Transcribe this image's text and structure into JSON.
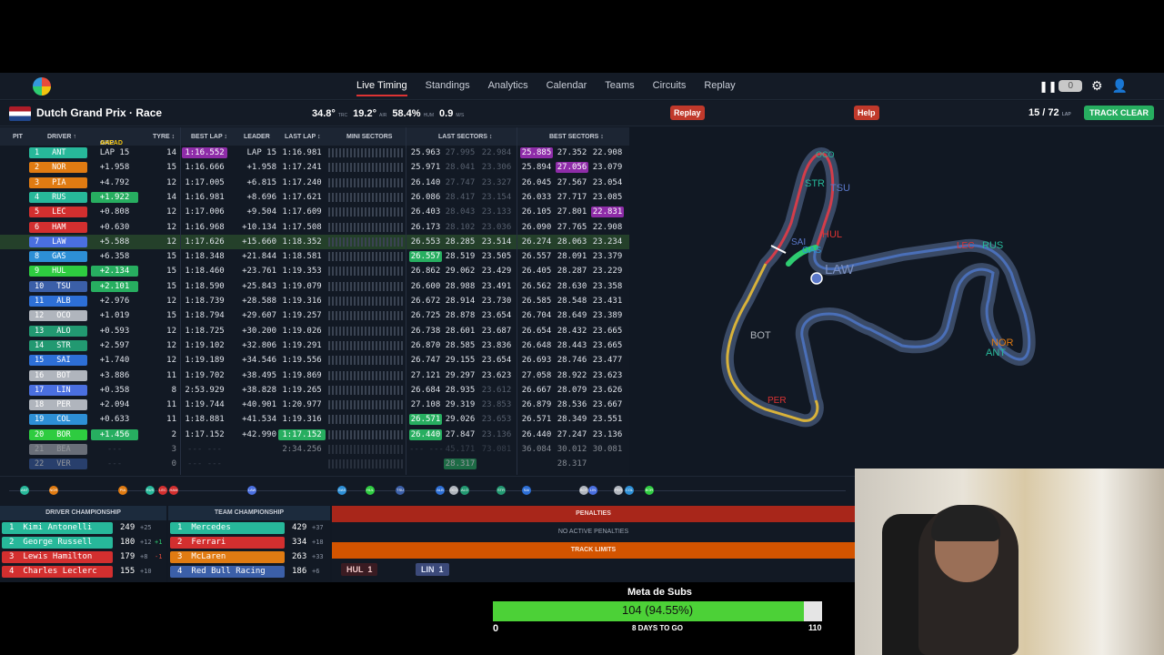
{
  "nav": {
    "links": [
      "Live Timing",
      "Standings",
      "Analytics",
      "Calendar",
      "Teams",
      "Circuits",
      "Replay"
    ],
    "counter": "0"
  },
  "session": {
    "title": "Dutch Grand Prix · Race",
    "track_temp": "34.8°",
    "track_unit": "TRC",
    "air_temp": "19.2°",
    "air_unit": "AIR",
    "humidity": "58.4%",
    "hum_unit": "HUM",
    "wind": "0.9",
    "wind_unit": "M/S",
    "replay_label": "Replay",
    "help_label": "Help",
    "lap": "15 / 72",
    "lap_unit": "LAP",
    "track_status": "TRACK CLEAR"
  },
  "table_headers": {
    "pit": "PIT",
    "driver": "DRIVER ↑",
    "gap": "GAP",
    "gap_mode": "AHEAD",
    "tyre": "TYRE ↕",
    "best": "BEST LAP ↕",
    "leader": "LEADER",
    "last": "LAST LAP ↕",
    "mini": "MINI SECTORS",
    "last_sectors": "LAST SECTORS ↕",
    "best_sectors": "BEST SECTORS ↕"
  },
  "colors": {
    "mercedes": "#27b89a",
    "mclaren": "#e07b12",
    "ferrari": "#d32f2f",
    "redbull": "#3b5fa8",
    "williams": "#2d6fd6",
    "rb": "#4a6fe0",
    "aston": "#229971",
    "haas": "#b0b5bd",
    "sauber": "#2ecc40",
    "alpine": "#2d8fd6",
    "purple": "#8e2ca8",
    "green": "#27ae60"
  },
  "drivers": [
    {
      "pos": "1",
      "code": "ANT",
      "team": "mercedes",
      "gap": "LAP 15",
      "gap_style": "",
      "tyre": "14",
      "best": "1:16.552",
      "best_style": "p",
      "leader": "LAP 15",
      "last": "1:16.981",
      "last_style": "",
      "s1": "25.963",
      "s1s": "",
      "s2": "27.995",
      "s2s": "dim",
      "s3": "22.984",
      "s3s": "dim",
      "b1": "25.885",
      "b1s": "p",
      "b2": "27.352",
      "b2s": "",
      "b3": "22.908",
      "b3s": ""
    },
    {
      "pos": "2",
      "code": "NOR",
      "team": "mclaren",
      "gap": "+1.958",
      "gap_style": "",
      "tyre": "15",
      "best": "1:16.666",
      "best_style": "",
      "leader": "+1.958",
      "last": "1:17.241",
      "last_style": "",
      "s1": "25.971",
      "s1s": "",
      "s2": "28.041",
      "s2s": "dim",
      "s3": "23.306",
      "s3s": "dim",
      "b1": "25.894",
      "b1s": "",
      "b2": "27.056",
      "b2s": "p",
      "b3": "23.079",
      "b3s": ""
    },
    {
      "pos": "3",
      "code": "PIA",
      "team": "mclaren",
      "gap": "+4.792",
      "gap_style": "",
      "tyre": "12",
      "best": "1:17.005",
      "best_style": "",
      "leader": "+6.815",
      "last": "1:17.240",
      "last_style": "",
      "s1": "26.140",
      "s1s": "",
      "s2": "27.747",
      "s2s": "dim",
      "s3": "23.327",
      "s3s": "dim",
      "b1": "26.045",
      "b1s": "",
      "b2": "27.567",
      "b2s": "",
      "b3": "23.054",
      "b3s": ""
    },
    {
      "pos": "4",
      "code": "RUS",
      "team": "mercedes",
      "gap": "+1.922",
      "gap_style": "g",
      "tyre": "14",
      "best": "1:16.981",
      "best_style": "",
      "leader": "+8.696",
      "last": "1:17.621",
      "last_style": "",
      "s1": "26.086",
      "s1s": "",
      "s2": "28.417",
      "s2s": "dim",
      "s3": "23.154",
      "s3s": "dim",
      "b1": "26.033",
      "b1s": "",
      "b2": "27.717",
      "b2s": "",
      "b3": "23.085",
      "b3s": ""
    },
    {
      "pos": "5",
      "code": "LEC",
      "team": "ferrari",
      "gap": "+0.808",
      "gap_style": "",
      "tyre": "12",
      "best": "1:17.006",
      "best_style": "",
      "leader": "+9.504",
      "last": "1:17.609",
      "last_style": "",
      "s1": "26.403",
      "s1s": "",
      "s2": "28.043",
      "s2s": "dim",
      "s3": "23.133",
      "s3s": "dim",
      "b1": "26.105",
      "b1s": "",
      "b2": "27.801",
      "b2s": "",
      "b3": "22.831",
      "b3s": "p"
    },
    {
      "pos": "6",
      "code": "HAM",
      "team": "ferrari",
      "gap": "+0.630",
      "gap_style": "",
      "tyre": "12",
      "best": "1:16.968",
      "best_style": "",
      "leader": "+10.134",
      "last": "1:17.508",
      "last_style": "",
      "s1": "26.173",
      "s1s": "",
      "s2": "28.102",
      "s2s": "dim",
      "s3": "23.036",
      "s3s": "dim",
      "b1": "26.090",
      "b1s": "",
      "b2": "27.765",
      "b2s": "",
      "b3": "22.908",
      "b3s": ""
    },
    {
      "pos": "7",
      "code": "LAW",
      "team": "rb",
      "gap": "+5.588",
      "gap_style": "",
      "tyre": "12",
      "best": "1:17.626",
      "best_style": "",
      "leader": "+15.660",
      "last": "1:18.352",
      "last_style": "",
      "s1": "26.553",
      "s1s": "",
      "s2": "28.285",
      "s2s": "",
      "s3": "23.514",
      "s3s": "",
      "b1": "26.274",
      "b1s": "",
      "b2": "28.063",
      "b2s": "",
      "b3": "23.234",
      "b3s": "",
      "hl": true
    },
    {
      "pos": "8",
      "code": "GAS",
      "team": "alpine",
      "gap": "+6.358",
      "gap_style": "",
      "tyre": "15",
      "best": "1:18.348",
      "best_style": "",
      "leader": "+21.844",
      "last": "1:18.581",
      "last_style": "",
      "s1": "26.557",
      "s1s": "g",
      "s2": "28.519",
      "s2s": "",
      "s3": "23.505",
      "s3s": "",
      "b1": "26.557",
      "b1s": "",
      "b2": "28.091",
      "b2s": "",
      "b3": "23.379",
      "b3s": ""
    },
    {
      "pos": "9",
      "code": "HUL",
      "team": "sauber",
      "gap": "+2.134",
      "gap_style": "g",
      "tyre": "15",
      "best": "1:18.460",
      "best_style": "",
      "leader": "+23.761",
      "last": "1:19.353",
      "last_style": "",
      "s1": "26.862",
      "s1s": "",
      "s2": "29.062",
      "s2s": "",
      "s3": "23.429",
      "s3s": "",
      "b1": "26.405",
      "b1s": "",
      "b2": "28.287",
      "b2s": "",
      "b3": "23.229",
      "b3s": ""
    },
    {
      "pos": "10",
      "code": "TSU",
      "team": "redbull",
      "gap": "+2.101",
      "gap_style": "g",
      "tyre": "15",
      "best": "1:18.590",
      "best_style": "",
      "leader": "+25.843",
      "last": "1:19.079",
      "last_style": "",
      "s1": "26.600",
      "s1s": "",
      "s2": "28.988",
      "s2s": "",
      "s3": "23.491",
      "s3s": "",
      "b1": "26.562",
      "b1s": "",
      "b2": "28.630",
      "b2s": "",
      "b3": "23.358",
      "b3s": ""
    },
    {
      "pos": "11",
      "code": "ALB",
      "team": "williams",
      "gap": "+2.976",
      "gap_style": "",
      "tyre": "12",
      "best": "1:18.739",
      "best_style": "",
      "leader": "+28.588",
      "last": "1:19.316",
      "last_style": "",
      "s1": "26.672",
      "s1s": "",
      "s2": "28.914",
      "s2s": "",
      "s3": "23.730",
      "s3s": "",
      "b1": "26.585",
      "b1s": "",
      "b2": "28.548",
      "b2s": "",
      "b3": "23.431",
      "b3s": ""
    },
    {
      "pos": "12",
      "code": "OCO",
      "team": "haas",
      "gap": "+1.019",
      "gap_style": "",
      "tyre": "15",
      "best": "1:18.794",
      "best_style": "",
      "leader": "+29.607",
      "last": "1:19.257",
      "last_style": "",
      "s1": "26.725",
      "s1s": "",
      "s2": "28.878",
      "s2s": "",
      "s3": "23.654",
      "s3s": "",
      "b1": "26.704",
      "b1s": "",
      "b2": "28.649",
      "b2s": "",
      "b3": "23.389",
      "b3s": ""
    },
    {
      "pos": "13",
      "code": "ALO",
      "team": "aston",
      "gap": "+0.593",
      "gap_style": "",
      "tyre": "12",
      "best": "1:18.725",
      "best_style": "",
      "leader": "+30.200",
      "last": "1:19.026",
      "last_style": "",
      "s1": "26.738",
      "s1s": "",
      "s2": "28.601",
      "s2s": "",
      "s3": "23.687",
      "s3s": "",
      "b1": "26.654",
      "b1s": "",
      "b2": "28.432",
      "b2s": "",
      "b3": "23.665",
      "b3s": ""
    },
    {
      "pos": "14",
      "code": "STR",
      "team": "aston",
      "gap": "+2.597",
      "gap_style": "",
      "tyre": "12",
      "best": "1:19.102",
      "best_style": "",
      "leader": "+32.806",
      "last": "1:19.291",
      "last_style": "",
      "s1": "26.870",
      "s1s": "",
      "s2": "28.585",
      "s2s": "",
      "s3": "23.836",
      "s3s": "",
      "b1": "26.648",
      "b1s": "",
      "b2": "28.443",
      "b2s": "",
      "b3": "23.665",
      "b3s": ""
    },
    {
      "pos": "15",
      "code": "SAI",
      "team": "williams",
      "gap": "+1.740",
      "gap_style": "",
      "tyre": "12",
      "best": "1:19.189",
      "best_style": "",
      "leader": "+34.546",
      "last": "1:19.556",
      "last_style": "",
      "s1": "26.747",
      "s1s": "",
      "s2": "29.155",
      "s2s": "",
      "s3": "23.654",
      "s3s": "",
      "b1": "26.693",
      "b1s": "",
      "b2": "28.746",
      "b2s": "",
      "b3": "23.477",
      "b3s": ""
    },
    {
      "pos": "16",
      "code": "BOT",
      "team": "haas",
      "gap": "+3.886",
      "gap_style": "",
      "tyre": "11",
      "best": "1:19.702",
      "best_style": "",
      "leader": "+38.495",
      "last": "1:19.869",
      "last_style": "",
      "s1": "27.121",
      "s1s": "",
      "s2": "29.297",
      "s2s": "",
      "s3": "23.623",
      "s3s": "",
      "b1": "27.058",
      "b1s": "",
      "b2": "28.922",
      "b2s": "",
      "b3": "23.623",
      "b3s": ""
    },
    {
      "pos": "17",
      "code": "LIN",
      "team": "rb",
      "gap": "+0.358",
      "gap_style": "",
      "tyre": "8",
      "best": "2:53.929",
      "best_style": "",
      "leader": "+38.828",
      "last": "1:19.265",
      "last_style": "",
      "s1": "26.684",
      "s1s": "",
      "s2": "28.935",
      "s2s": "",
      "s3": "23.612",
      "s3s": "dim",
      "b1": "26.667",
      "b1s": "",
      "b2": "28.079",
      "b2s": "",
      "b3": "23.626",
      "b3s": ""
    },
    {
      "pos": "18",
      "code": "PER",
      "team": "haas",
      "gap": "+2.094",
      "gap_style": "",
      "tyre": "11",
      "best": "1:19.744",
      "best_style": "",
      "leader": "+40.901",
      "last": "1:20.977",
      "last_style": "",
      "s1": "27.108",
      "s1s": "",
      "s2": "29.319",
      "s2s": "",
      "s3": "23.853",
      "s3s": "dim",
      "b1": "26.879",
      "b1s": "",
      "b2": "28.536",
      "b2s": "",
      "b3": "23.667",
      "b3s": ""
    },
    {
      "pos": "19",
      "code": "COL",
      "team": "alpine",
      "gap": "+0.633",
      "gap_style": "",
      "tyre": "11",
      "best": "1:18.881",
      "best_style": "",
      "leader": "+41.534",
      "last": "1:19.316",
      "last_style": "",
      "s1": "26.571",
      "s1s": "g",
      "s2": "29.026",
      "s2s": "",
      "s3": "23.653",
      "s3s": "dim",
      "b1": "26.571",
      "b1s": "",
      "b2": "28.349",
      "b2s": "",
      "b3": "23.551",
      "b3s": ""
    },
    {
      "pos": "20",
      "code": "BOR",
      "team": "sauber",
      "gap": "+1.456",
      "gap_style": "g",
      "tyre": "2",
      "best": "1:17.152",
      "best_style": "",
      "leader": "+42.990",
      "last": "1:17.152",
      "last_style": "g",
      "s1": "26.440",
      "s1s": "g",
      "s2": "27.847",
      "s2s": "",
      "s3": "23.136",
      "s3s": "dim",
      "b1": "26.440",
      "b1s": "",
      "b2": "27.247",
      "b2s": "",
      "b3": "23.136",
      "b3s": ""
    },
    {
      "pos": "21",
      "code": "BEA",
      "team": "haas",
      "gap": "---",
      "gap_style": "dim",
      "tyre": "3",
      "best": "--- ---",
      "best_style": "dim",
      "leader": "",
      "last": "2:34.256",
      "last_style": "",
      "s1": "--- ---",
      "s1s": "dim",
      "s2": "45.171",
      "s2s": "dim",
      "s3": "73.081",
      "s3s": "dim",
      "b1": "36.084",
      "b1s": "",
      "b2": "30.012",
      "b2s": "",
      "b3": "30.081",
      "b3s": "",
      "out": true
    },
    {
      "pos": "22",
      "code": "VER",
      "team": "redbull",
      "gap": "---",
      "gap_style": "dim",
      "tyre": "0",
      "best": "--- ---",
      "best_style": "dim",
      "leader": "",
      "last": "",
      "last_style": "",
      "s1": "",
      "s1s": "",
      "s2": "28.317",
      "s2s": "g",
      "s3": "",
      "s3s": "",
      "b1": "",
      "b1s": "",
      "b2": "28.317",
      "b2s": "",
      "b3": "",
      "b3s": "",
      "out": true
    }
  ],
  "track_labels": [
    "ANT",
    "NOR",
    "PIA",
    "RUS",
    "LEC",
    "HAM",
    "LAW",
    "GAS",
    "HUL",
    "TSU",
    "ALB",
    "OCO",
    "ALO",
    "STR",
    "SAI",
    "BOT",
    "LIN",
    "PER",
    "COL",
    "BOR"
  ],
  "strip_labels": [
    "ANT",
    "NOR",
    "PIA",
    "RUS",
    "LEC",
    "HAM",
    "LAW",
    "GAS",
    "HUL",
    "TSU",
    "ALB",
    "OCO",
    "ALO",
    "STR",
    "SAI",
    "BOT",
    "LIN",
    "PER",
    "COL",
    "BOR"
  ],
  "driver_championship": {
    "title": "DRIVER CHAMPIONSHIP",
    "rows": [
      {
        "pos": "1",
        "name": "Kimi Antonelli",
        "team": "mercedes",
        "pts": "249",
        "delta": "+25",
        "change": ""
      },
      {
        "pos": "2",
        "name": "George Russell",
        "team": "mercedes",
        "pts": "180",
        "delta": "+12",
        "change": "+1"
      },
      {
        "pos": "3",
        "name": "Lewis Hamilton",
        "team": "ferrari",
        "pts": "179",
        "delta": "+8",
        "change": "-1"
      },
      {
        "pos": "4",
        "name": "Charles Leclerc",
        "team": "ferrari",
        "pts": "155",
        "delta": "+10",
        "change": ""
      }
    ]
  },
  "team_championship": {
    "title": "TEAM CHAMPIONSHIP",
    "rows": [
      {
        "pos": "1",
        "name": "Mercedes",
        "team": "mercedes",
        "pts": "429",
        "delta": "+37"
      },
      {
        "pos": "2",
        "name": "Ferrari",
        "team": "ferrari",
        "pts": "334",
        "delta": "+18"
      },
      {
        "pos": "3",
        "name": "McLaren",
        "team": "mclaren",
        "pts": "263",
        "delta": "+33"
      },
      {
        "pos": "4",
        "name": "Red Bull Racing",
        "team": "redbull",
        "pts": "186",
        "delta": "+6"
      }
    ]
  },
  "penalties": {
    "title": "PENALTIES",
    "none": "NO ACTIVE PENALTIES",
    "track_limits": "TRACK LIMITS",
    "tags": [
      {
        "code": "HUL",
        "count": "1",
        "team": "sauber"
      },
      {
        "code": "LIN",
        "count": "1",
        "team": "rb"
      }
    ]
  },
  "goal": {
    "title": "Meta de Subs",
    "text": "104 (94.55%)",
    "progress": 0.9455,
    "min": "0",
    "max": "110",
    "days": "8 DAYS TO GO"
  }
}
